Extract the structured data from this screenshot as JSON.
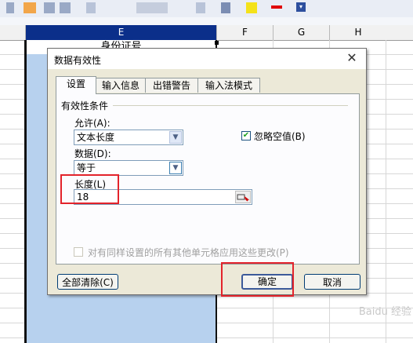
{
  "spreadsheet": {
    "columns": [
      "E",
      "F",
      "G",
      "H"
    ],
    "cell_E1": "身份证号"
  },
  "dialog": {
    "title": "数据有效性",
    "close_glyph": "✕",
    "tabs": [
      {
        "label": "设置",
        "active": true
      },
      {
        "label": "输入信息",
        "active": false
      },
      {
        "label": "出错警告",
        "active": false
      },
      {
        "label": "输入法模式",
        "active": false
      }
    ],
    "group_title": "有效性条件",
    "allow": {
      "label": "允许(A):",
      "value": "文本长度"
    },
    "data": {
      "label": "数据(D):",
      "value": "等于"
    },
    "length": {
      "label": "长度(L)",
      "value": "18"
    },
    "ignore_blank": {
      "label": "忽略空值(B)",
      "checked": true
    },
    "apply_all": {
      "label": "对有同样设置的所有其他单元格应用这些更改(P)",
      "checked": false,
      "enabled": false
    },
    "buttons": {
      "clear_all": "全部清除(C)",
      "ok": "确定",
      "cancel": "取消"
    }
  },
  "watermark": {
    "text": "Baidu 经验"
  },
  "colors": {
    "accent": "#0b2f8a",
    "selection": "#b7d1ee",
    "highlight": "#e3232b"
  }
}
